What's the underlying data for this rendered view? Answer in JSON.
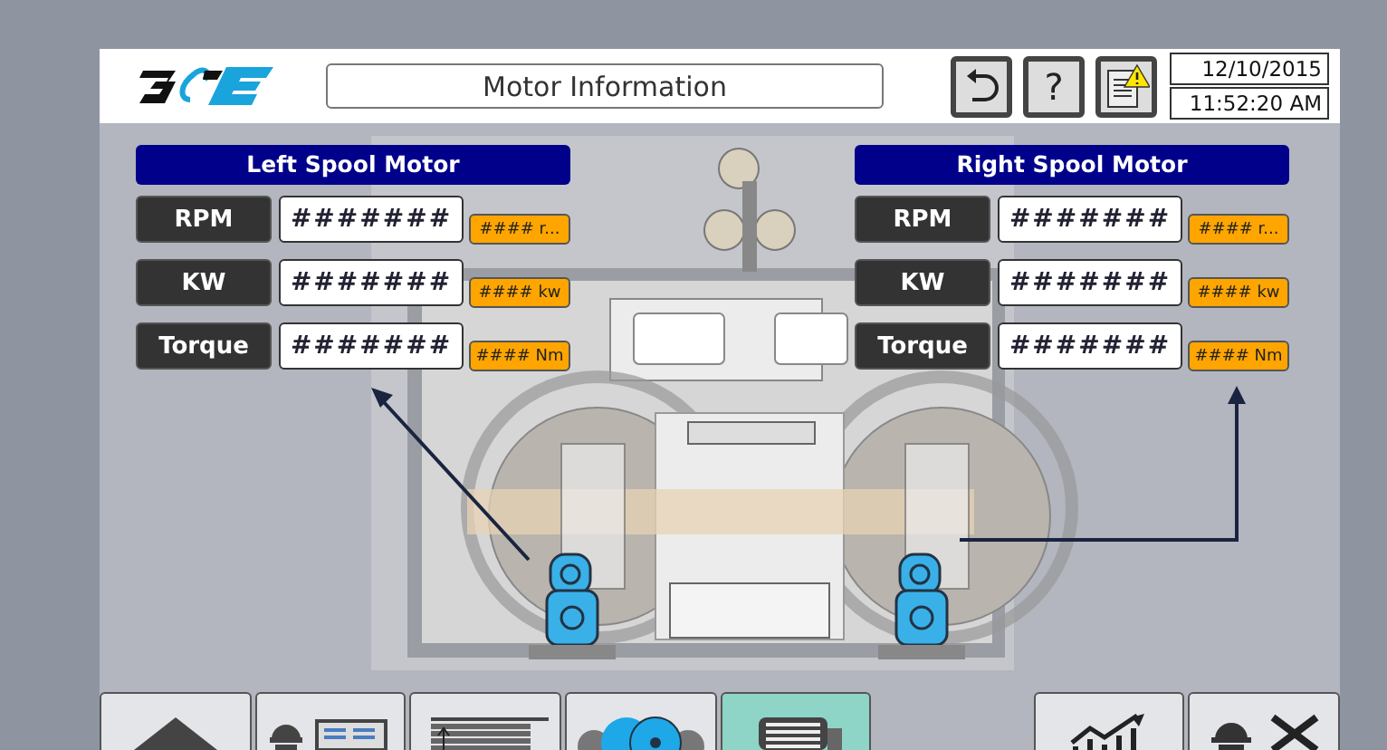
{
  "header": {
    "title": "Motor Information",
    "help_label": "?",
    "date": "12/10/2015",
    "time": "11:52:20 AM"
  },
  "panels": [
    {
      "title": "Left Spool Motor",
      "rows": [
        {
          "label": "RPM",
          "value": "#######",
          "unit": "#### r..."
        },
        {
          "label": "KW",
          "value": "#######",
          "unit": "#### kw"
        },
        {
          "label": "Torque",
          "value": "#######",
          "unit": "#### Nm"
        }
      ]
    },
    {
      "title": "Right Spool Motor",
      "rows": [
        {
          "label": "RPM",
          "value": "#######",
          "unit": "#### r..."
        },
        {
          "label": "KW",
          "value": "#######",
          "unit": "#### kw"
        },
        {
          "label": "Torque",
          "value": "#######",
          "unit": "#### Nm"
        }
      ]
    }
  ],
  "nav": [
    {
      "selected": false
    },
    {
      "selected": false
    },
    {
      "selected": false
    },
    {
      "selected": false
    },
    {
      "selected": true
    },
    {
      "selected": false
    },
    {
      "selected": false
    }
  ]
}
